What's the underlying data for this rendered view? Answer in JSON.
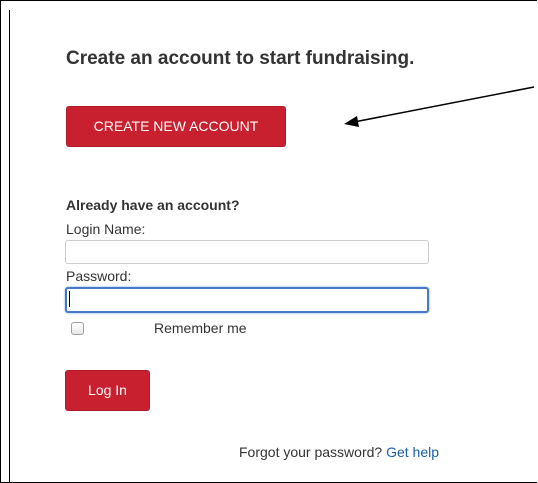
{
  "signup": {
    "heading": "Create an account to start fundraising.",
    "create_button_label": "CREATE NEW ACCOUNT"
  },
  "login": {
    "prompt": "Already have an account?",
    "login_name_label": "Login Name:",
    "login_name_value": "",
    "password_label": "Password:",
    "password_value": "",
    "remember_me_label": "Remember me",
    "remember_me_checked": false,
    "login_button_label": "Log In"
  },
  "help": {
    "forgot_text": "Forgot your password?",
    "get_help_link": "Get help"
  },
  "colors": {
    "brand_red": "#c8202e",
    "link_blue": "#1a5fa8",
    "focus_blue": "#4a78c8"
  }
}
